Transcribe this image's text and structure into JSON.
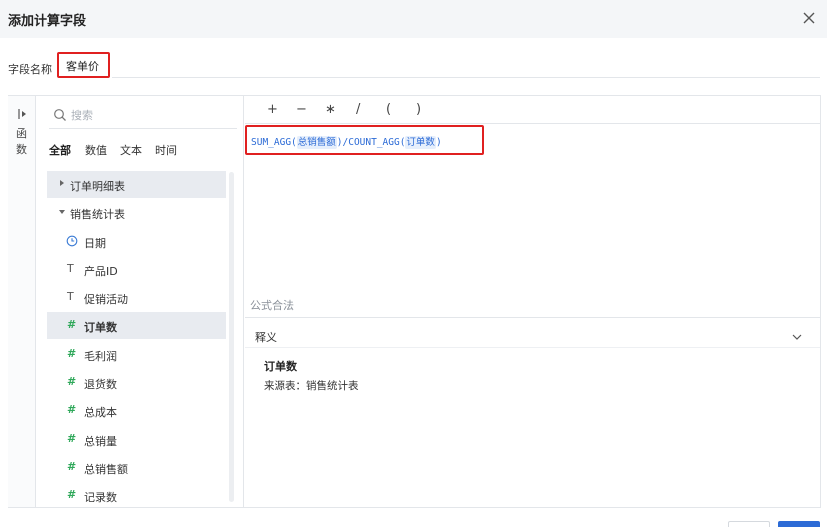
{
  "dialog": {
    "title": "添加计算字段"
  },
  "field_name": {
    "label": "字段名称",
    "value": "客单价"
  },
  "functions_tab": {
    "label": "函数"
  },
  "field_panel": {
    "search_placeholder": "搜索",
    "type_tabs": [
      {
        "label": "全部",
        "active": true
      },
      {
        "label": "数值",
        "active": false
      },
      {
        "label": "文本",
        "active": false
      },
      {
        "label": "时间",
        "active": false
      }
    ],
    "tables": [
      {
        "label": "订单明细表",
        "expanded": false,
        "selected": true
      },
      {
        "label": "销售统计表",
        "expanded": true,
        "selected": false
      }
    ],
    "fields": [
      {
        "label": "日期",
        "type_icon": "clock-icon",
        "selected": false
      },
      {
        "label": "产品ID",
        "type_icon": "text-type-icon",
        "selected": false
      },
      {
        "label": "促销活动",
        "type_icon": "text-type-icon",
        "selected": false
      },
      {
        "label": "订单数",
        "type_icon": "number-type-icon",
        "selected": true
      },
      {
        "label": "毛利润",
        "type_icon": "number-type-icon",
        "selected": false
      },
      {
        "label": "退货数",
        "type_icon": "number-type-icon",
        "selected": false
      },
      {
        "label": "总成本",
        "type_icon": "number-type-icon",
        "selected": false
      },
      {
        "label": "总销量",
        "type_icon": "number-type-icon",
        "selected": false
      },
      {
        "label": "总销售额",
        "type_icon": "number-type-icon",
        "selected": false
      },
      {
        "label": "记录数",
        "type_icon": "record-count-icon",
        "selected": false
      }
    ]
  },
  "operators": [
    "+",
    "−",
    "∗",
    "/",
    "(",
    ")"
  ],
  "formula": {
    "func1": "SUM_AGG(",
    "arg1": "总销售额",
    "mid": ")/COUNT_AGG(",
    "arg2": "订单数",
    "end": ")"
  },
  "syntax_status": "公式合法",
  "definition": {
    "header": "释义",
    "field_name": "订单数",
    "source": "来源表：销售统计表"
  },
  "colors": {
    "accent": "#2c6bd6",
    "highlight_border": "#e02020",
    "number_icon": "#2fa85a",
    "selected_row": "#e8ebf0"
  }
}
